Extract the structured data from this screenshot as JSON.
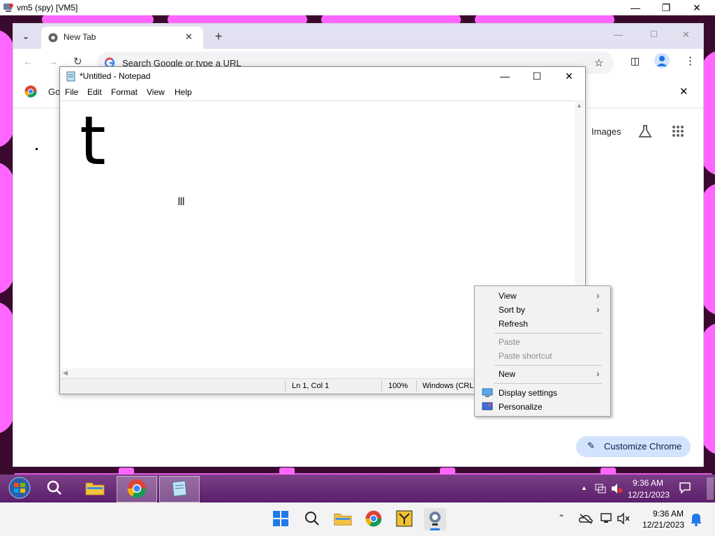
{
  "host": {
    "title": "vm5 (spy) [VM5]",
    "minimize_icon": "minimize-icon",
    "maximize_icon": "restore-icon",
    "close_icon": "close-icon"
  },
  "chrome": {
    "tab_title": "New Tab",
    "omnibox_placeholder": "Search Google or type a URL",
    "bookmark_google_label": "Go",
    "images_link": "Images",
    "customize_label": "Customize Chrome"
  },
  "notepad": {
    "title": "*Untitled - Notepad",
    "menu": [
      "File",
      "Edit",
      "Format",
      "View",
      "Help"
    ],
    "content": "t",
    "status": {
      "position": "Ln 1, Col 1",
      "zoom": "100%",
      "line_ending": "Windows (CRL"
    }
  },
  "context_menu": {
    "items": [
      {
        "label": "View",
        "has_submenu": true,
        "disabled": false
      },
      {
        "label": "Sort by",
        "has_submenu": true,
        "disabled": false
      },
      {
        "label": "Refresh",
        "has_submenu": false,
        "disabled": false
      },
      {
        "label": "Paste",
        "has_submenu": false,
        "disabled": true
      },
      {
        "label": "Paste shortcut",
        "has_submenu": false,
        "disabled": true
      },
      {
        "label": "New",
        "has_submenu": true,
        "disabled": false
      },
      {
        "label": "Display settings",
        "has_submenu": false,
        "disabled": false,
        "icon": "display-icon"
      },
      {
        "label": "Personalize",
        "has_submenu": false,
        "disabled": false,
        "icon": "personalize-icon"
      }
    ]
  },
  "taskbar_inner": {
    "time": "9:36 AM",
    "date": "12/21/2023"
  },
  "taskbar_outer": {
    "time": "9:36 AM",
    "date": "12/21/2023"
  },
  "colors": {
    "wallpaper": "#3a0a2e",
    "wallpaper_accent": "#ff66ff",
    "chrome_tabstrip": "#e1e1f2",
    "customize_button": "#d3e3fd",
    "win7_taskbar": "#6a2f7a"
  }
}
